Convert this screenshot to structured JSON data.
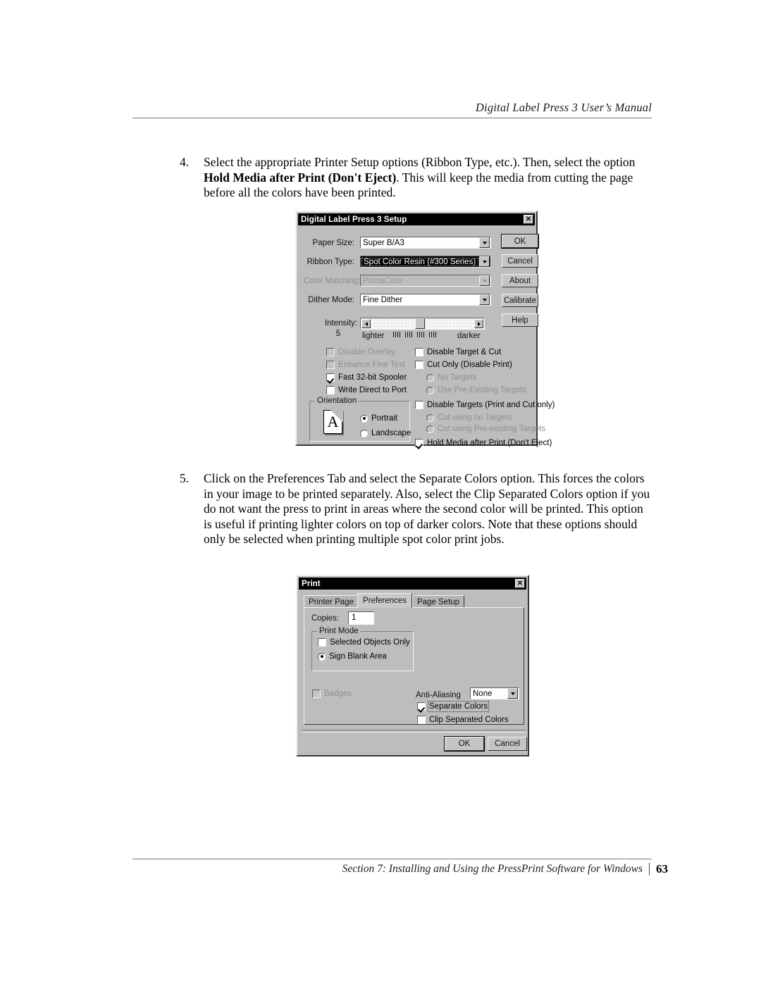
{
  "page": {
    "header_title": "Digital Label Press 3 User’s Manual",
    "footer_text": "Section 7:  Installing and Using the PressPrint Software for Windows",
    "footer_page_number": "63"
  },
  "steps": [
    {
      "number": "4.",
      "text_before": "Select the appropriate Printer Setup options (Ribbon Type, etc.).  Then, select the option ",
      "bold": "Hold Media after Print (Don't Eject)",
      "text_after": ".  This will keep the media from cutting the page before all the colors have been printed."
    },
    {
      "number": "5.",
      "text": "Click on the Preferences Tab and select the Separate Colors option.  This forces the colors in your image to be printed separately.  Also, select the Clip Separated Colors option if you do not want the press to print in areas where the second color will be printed.  This option is useful if printing lighter colors on top of darker colors.  Note that these options should only be selected when printing multiple spot color print jobs."
    }
  ],
  "setup_dialog": {
    "title": "Digital Label Press 3 Setup",
    "close_label": "✕",
    "fields": [
      {
        "label": "Paper Size:",
        "value": "Super B/A3",
        "state": "normal"
      },
      {
        "label": "Ribbon Type:",
        "value": "Spot Color Resin (#300 Series)",
        "state": "selected"
      },
      {
        "label": "Color Matching:",
        "value": "PrimaColor",
        "state": "disabled"
      },
      {
        "label": "Dither Mode:",
        "value": "Fine Dither",
        "state": "normal"
      }
    ],
    "intensity": {
      "label": "Intensity:",
      "value": "5",
      "left_label": "lighter",
      "right_label": "darker",
      "left_arrow": "◄",
      "right_arrow": "►"
    },
    "buttons": [
      {
        "label": "OK",
        "default": true
      },
      {
        "label": "Cancel",
        "default": false
      },
      {
        "label": "About",
        "default": false
      },
      {
        "label": "Calibrate",
        "default": false,
        "accel": "a"
      },
      {
        "label": "Help",
        "default": false,
        "accel": "H"
      }
    ],
    "left_checks": [
      {
        "label": "Disable Overlay",
        "checked": false,
        "disabled": true
      },
      {
        "label": "Enhance Fine Text",
        "checked": false,
        "disabled": true
      },
      {
        "label": "Fast 32-bit Spooler",
        "checked": true,
        "disabled": false
      },
      {
        "label": "Write Direct to Port",
        "checked": false,
        "disabled": false
      }
    ],
    "right_controls": [
      {
        "type": "checkbox",
        "label": "Disable Target & Cut",
        "checked": false,
        "disabled": false
      },
      {
        "type": "checkbox",
        "label": "Cut Only (Disable Print)",
        "checked": false,
        "disabled": false
      },
      {
        "type": "radio",
        "label": "No Targets",
        "checked": false,
        "disabled": true
      },
      {
        "type": "radio",
        "label": "Use Pre-Existing Targets",
        "checked": false,
        "disabled": true
      },
      {
        "type": "checkbox",
        "label": "Disable Targets (Print and Cut only)",
        "checked": false,
        "disabled": false
      },
      {
        "type": "radio",
        "label": "Cut using no Targets",
        "checked": false,
        "disabled": true
      },
      {
        "type": "radio",
        "label": "Cut using Pre-existing Targets",
        "checked": false,
        "disabled": true
      },
      {
        "type": "checkbox",
        "label": "Hold Media after Print (Don't Eject)",
        "checked": true,
        "disabled": false
      }
    ],
    "orientation": {
      "group_title": "Orientation",
      "icon_glyph": "A",
      "options": [
        {
          "label": "Portrait",
          "checked": true
        },
        {
          "label": "Landscape",
          "checked": false
        }
      ]
    }
  },
  "print_dialog": {
    "title": "Print",
    "close_label": "✕",
    "tabs": [
      {
        "label": "Printer Page",
        "active": false
      },
      {
        "label": "Preferences",
        "active": true
      },
      {
        "label": "Page Setup",
        "active": false
      }
    ],
    "copies": {
      "label": "Copies:",
      "value": "1"
    },
    "print_mode": {
      "group_title": "Print Mode",
      "options": [
        {
          "type": "checkbox",
          "label": "Selected Objects Only",
          "checked": false
        },
        {
          "type": "radio",
          "label": "Sign Blank Area",
          "checked": true
        }
      ]
    },
    "badges": {
      "label": "Badges",
      "checked": false,
      "disabled": true
    },
    "anti_aliasing": {
      "label": "Anti-Aliasing",
      "value": "None"
    },
    "color_options": [
      {
        "label": "Separate Colors",
        "checked": true,
        "focused": true
      },
      {
        "label": "Clip Separated Colors",
        "checked": false,
        "focused": false
      }
    ],
    "buttons": [
      {
        "label": "OK",
        "default": true
      },
      {
        "label": "Cancel",
        "default": false
      }
    ]
  }
}
